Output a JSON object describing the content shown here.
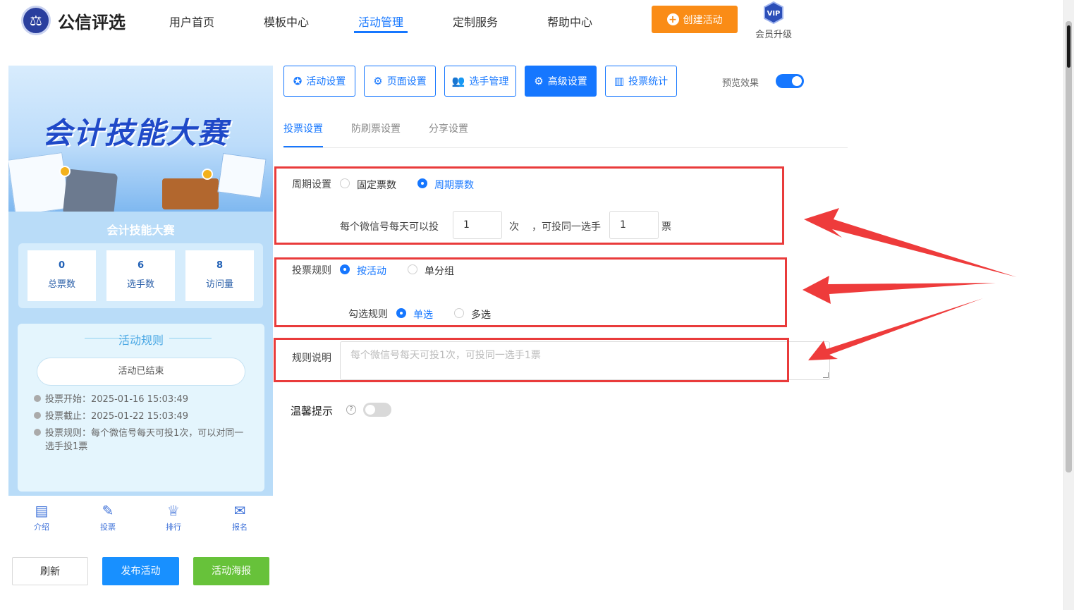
{
  "brand": {
    "name": "公信评选"
  },
  "nav": {
    "items": [
      "用户首页",
      "模板中心",
      "活动管理",
      "定制服务",
      "帮助中心"
    ],
    "create_label": "创建活动",
    "vip_label": "会员升级",
    "vip_badge": "VIP"
  },
  "preview": {
    "banner_title": "会计技能大赛",
    "event_name": "会计技能大赛",
    "stats": [
      {
        "value": "0",
        "label": "总票数"
      },
      {
        "value": "6",
        "label": "选手数"
      },
      {
        "value": "8",
        "label": "访问量"
      }
    ],
    "rules_title": "活动规则",
    "status": "活动已结束",
    "rules": [
      "投票开始：2025-01-16 15:03:49",
      "投票截止：2025-01-22 15:03:49",
      "投票规则：每个微信号每天可投1次，可以对同一选手投1票"
    ],
    "tabbar": [
      {
        "label": "介绍",
        "icon": "document-icon"
      },
      {
        "label": "投票",
        "icon": "vote-icon"
      },
      {
        "label": "排行",
        "icon": "trophy-icon"
      },
      {
        "label": "报名",
        "icon": "signup-icon"
      }
    ]
  },
  "bottom_buttons": {
    "refresh": "刷新",
    "publish": "发布活动",
    "poster": "活动海报"
  },
  "toolbar": {
    "buttons": [
      "活动设置",
      "页面设置",
      "选手管理",
      "高级设置",
      "投票统计"
    ],
    "preview_label": "预览效果"
  },
  "subtabs": [
    "投票设置",
    "防刷票设置",
    "分享设置"
  ],
  "form": {
    "cycle_label": "周期设置",
    "cycle_options": [
      "固定票数",
      "周期票数"
    ],
    "per_day_label": "每个微信号每天可以投",
    "per_day_value": "1",
    "times_unit": "次",
    "same_player_label": "，可投同一选手",
    "same_player_value": "1",
    "ticket_unit": "票",
    "vote_rule_label": "投票规则",
    "vote_rule_options": [
      "按活动",
      "单分组"
    ],
    "check_rule_label": "勾选规则",
    "check_rule_options": [
      "单选",
      "多选"
    ],
    "description_label": "规则说明",
    "description_placeholder": "每个微信号每天可投1次，可投同一选手1票",
    "tip_label": "温馨提示"
  },
  "colors": {
    "accent": "#1677ff",
    "create_button": "#fa8c16",
    "publish_button": "#1890ff",
    "poster_button": "#67c23a",
    "annotation_red": "#e93b3b"
  }
}
